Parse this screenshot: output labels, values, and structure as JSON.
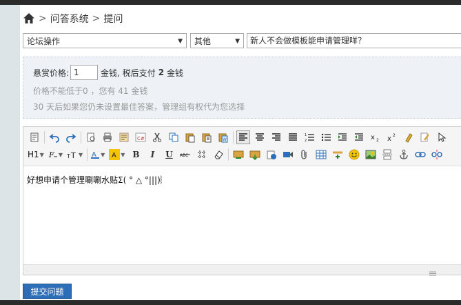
{
  "breadcrumb": {
    "items": [
      "问答系统",
      "提问"
    ],
    "separator": ">"
  },
  "form": {
    "forum_select": "论坛操作",
    "category_select": "其他",
    "title_value": "新人不会做模板能申请管理咩？"
  },
  "reward": {
    "label": "悬赏价格:",
    "value": "1",
    "after_value": "金钱, 税后支付",
    "after_tax": "2",
    "unit": "金钱",
    "hint_min": "价格不能低于0 ，您有 41 金钱",
    "hint_days": "30 天后如果您仍未设置最佳答案，管理组有权代为您选择"
  },
  "editor": {
    "heading_label": "H1",
    "body_text": "好想申请个管理唰唰水贴Σ( ° △ °|||)︴"
  },
  "actions": {
    "submit_label": "提交问题"
  },
  "colors": {
    "accent": "#2d6eb8",
    "sidebar": "#dce4e8",
    "topbar": "#2b2b2b",
    "reward_bg": "#eef2f6"
  }
}
